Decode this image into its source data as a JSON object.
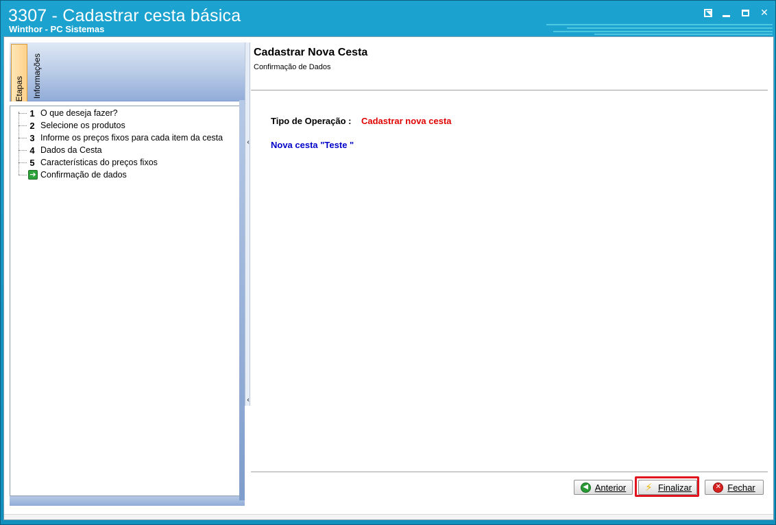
{
  "window": {
    "title": "3307 - Cadastrar cesta básica",
    "subtitle": "Winthor - PC Sistemas",
    "controls": [
      "restore-icon",
      "minimize-icon",
      "maximize-icon",
      "close-icon"
    ]
  },
  "sidebar": {
    "tabs": [
      {
        "label": "Etapas",
        "active": true
      },
      {
        "label": "Informações",
        "active": false
      }
    ],
    "steps": [
      {
        "num": "1",
        "label": "O que deseja fazer?"
      },
      {
        "num": "2",
        "label": "Selecione os produtos"
      },
      {
        "num": "3",
        "label": "Informe os preços fixos para cada item da cesta"
      },
      {
        "num": "4",
        "label": "Dados da Cesta"
      },
      {
        "num": "5",
        "label": "Características do preços fixos"
      },
      {
        "num": "",
        "label": "Confirmação de dados",
        "icon": "green-arrow-icon",
        "current": true
      }
    ]
  },
  "main": {
    "title": "Cadastrar Nova Cesta",
    "subtitle": "Confirmação de Dados",
    "operation_label": "Tipo de Operação :",
    "operation_value": "Cadastrar nova cesta",
    "description": "Nova cesta \"Teste \""
  },
  "buttons": {
    "anterior": "Anterior",
    "finalizar": "Finalizar",
    "fechar": "Fechar"
  },
  "colors": {
    "title_bar": "#1592c0",
    "operation_value": "#e00000",
    "description": "#0000c8",
    "highlight": "#e0141e"
  }
}
